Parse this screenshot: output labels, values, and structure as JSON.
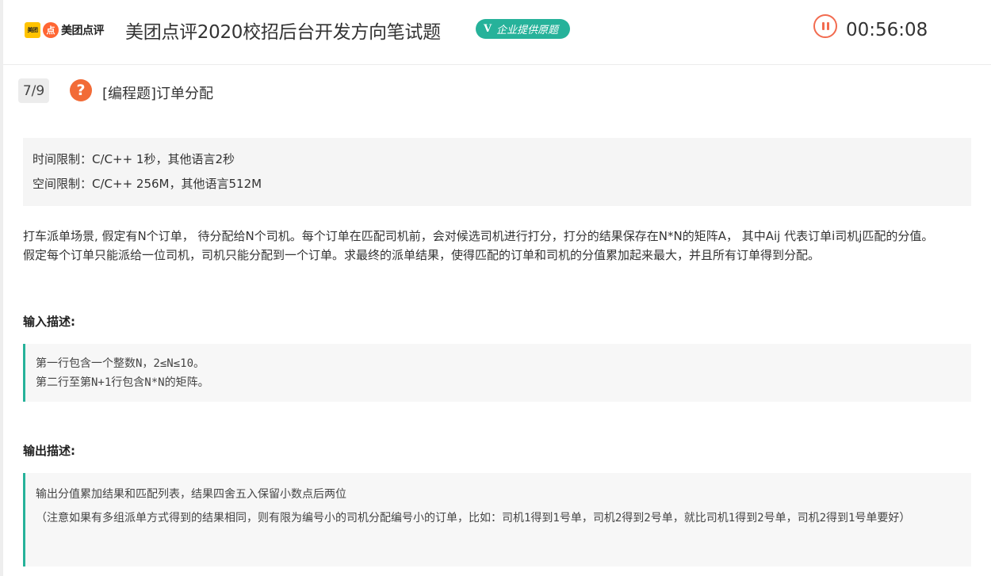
{
  "header": {
    "logo": {
      "mark_text": "美团",
      "dp_text": "点",
      "brand_text": "美团点评"
    },
    "exam_title": "美团点评2020校招后台开发方向笔试题",
    "badge_v": "V",
    "badge_label": "企业提供原题",
    "timer": "00:56:08",
    "pause_icon": "pause-icon"
  },
  "question": {
    "number": "7/9",
    "icon_glyph": "?",
    "title": "[编程题]订单分配",
    "limits": {
      "time": "时间限制：C/C++ 1秒，其他语言2秒",
      "space": "空间限制：C/C++ 256M，其他语言512M"
    },
    "description": [
      "打车派单场景, 假定有N个订单， 待分配给N个司机。每个订单在匹配司机前，会对候选司机进行打分，打分的结果保存在N*N的矩阵A， 其中Aij 代表订单i司机j匹配的分值。",
      "假定每个订单只能派给一位司机，司机只能分配到一个订单。求最终的派单结果，使得匹配的订单和司机的分值累加起来最大，并且所有订单得到分配。"
    ],
    "input": {
      "title": "输入描述:",
      "lines": [
        "第一行包含一个整数N，2≤N≤10。",
        "第二行至第N+1行包含N*N的矩阵。"
      ]
    },
    "output": {
      "title": "输出描述:",
      "lines": [
        "输出分值累加结果和匹配列表，结果四舍五入保留小数点后两位",
        "（注意如果有多组派单方式得到的结果相同，则有限为编号小的司机分配编号小的订单，比如：司机1得到1号单，司机2得到2号单，就比司机1得到2号单，司机2得到1号单要好）"
      ]
    }
  },
  "colors": {
    "accent_green": "#26b29a",
    "accent_orange": "#f26b37",
    "logo_yellow": "#ffc300"
  }
}
